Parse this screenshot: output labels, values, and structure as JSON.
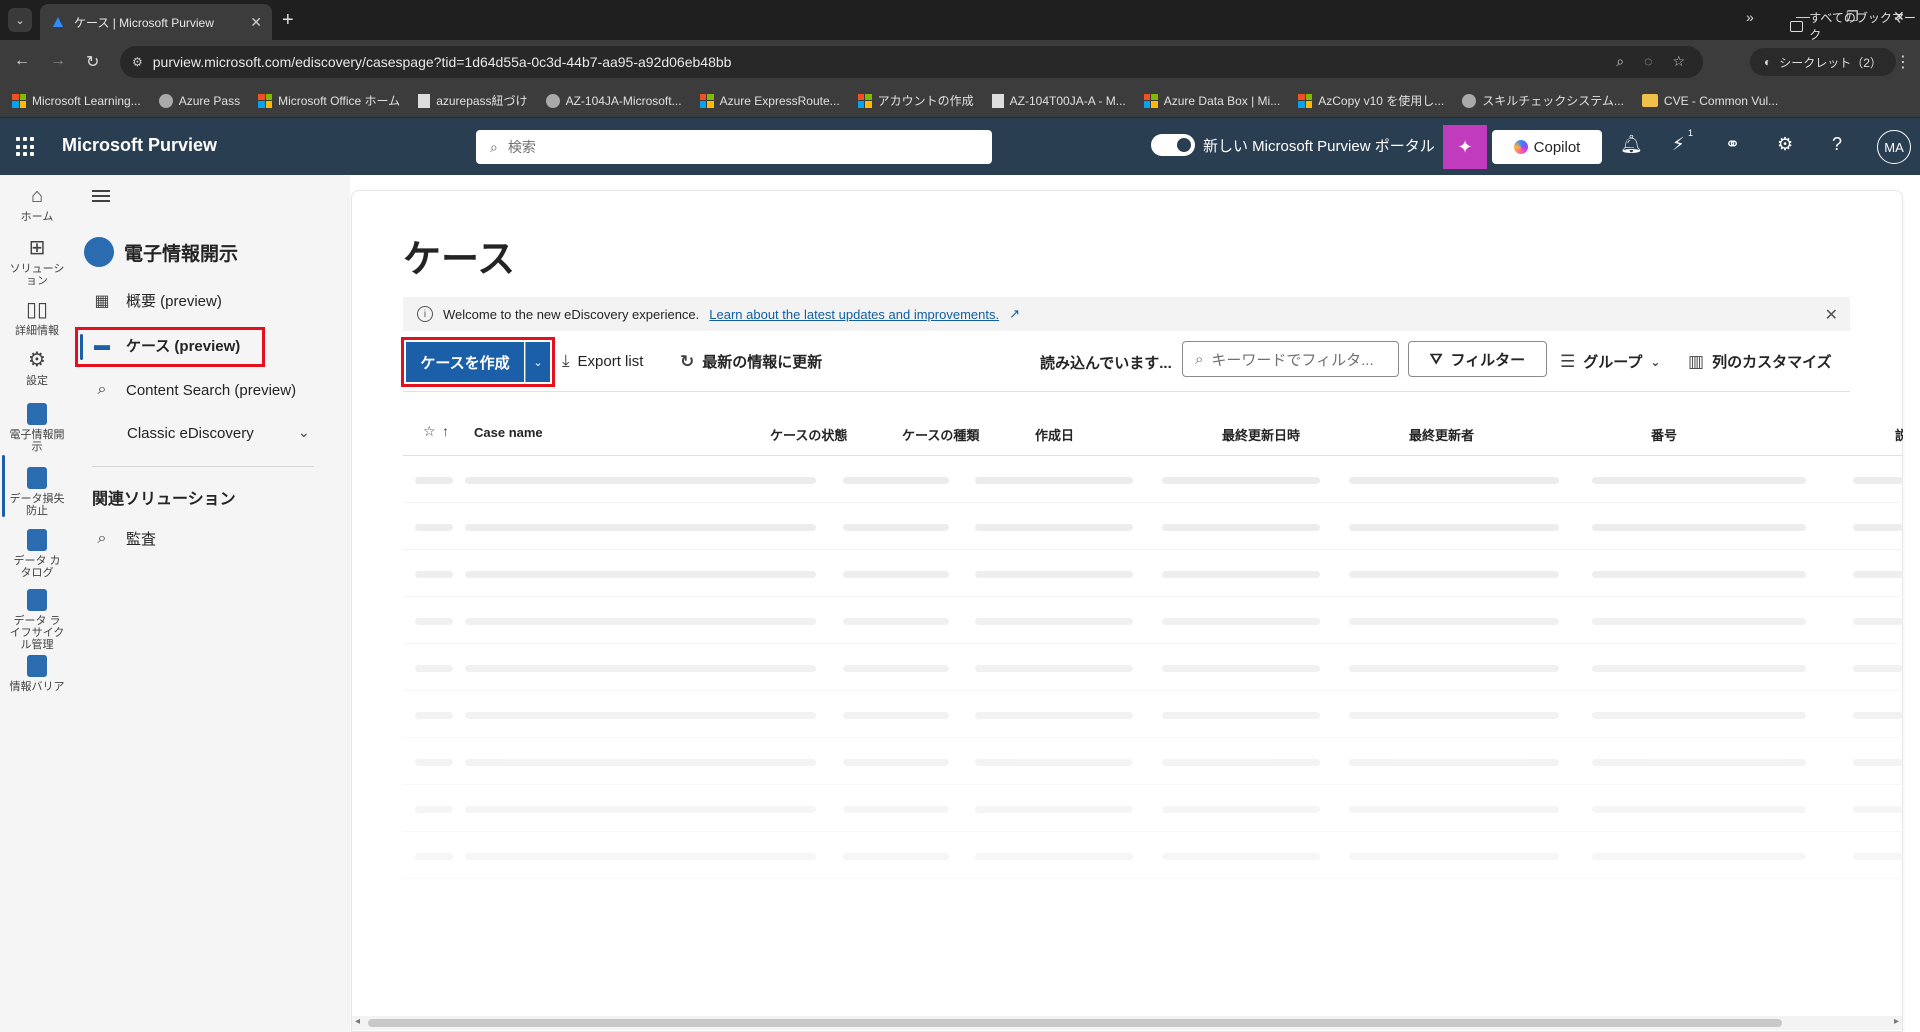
{
  "browser": {
    "tab_title": "ケース | Microsoft Purview",
    "url": "purview.microsoft.com/ediscovery/casespage?tid=1d64d55a-0c3d-44b7-aa95-a92d06eb48bb",
    "incognito_label": "シークレット（2）",
    "bookmarks": [
      {
        "label": "Microsoft Learning...",
        "icon": "ms-logo"
      },
      {
        "label": "Azure Pass",
        "icon": "globe-icon"
      },
      {
        "label": "Microsoft Office ホーム",
        "icon": "ms-logo"
      },
      {
        "label": "azurepass紐づけ",
        "icon": "doc-icon"
      },
      {
        "label": "AZ-104JA-Microsoft...",
        "icon": "github-icon"
      },
      {
        "label": "Azure ExpressRoute...",
        "icon": "ms-logo"
      },
      {
        "label": "アカウントの作成",
        "icon": "ms-logo"
      },
      {
        "label": "AZ-104T00JA-A - M...",
        "icon": "doc-icon"
      },
      {
        "label": "Azure Data Box | Mi...",
        "icon": "ms-logo"
      },
      {
        "label": "AzCopy v10 を使用し...",
        "icon": "ms-logo"
      },
      {
        "label": "スキルチェックシステム...",
        "icon": "globe-icon"
      },
      {
        "label": "CVE - Common Vul...",
        "icon": "folder-icon"
      }
    ],
    "bookmarks_more": "»",
    "all_bookmarks": "すべてのブックマーク"
  },
  "header": {
    "brand": "Microsoft Purview",
    "search_placeholder": "検索",
    "toggle_label": "新しい Microsoft Purview ポータル",
    "copilot_label": "Copilot",
    "notification_badge": "1",
    "avatar": "MA"
  },
  "rail": [
    {
      "label": "ホーム",
      "icon": "home-icon"
    },
    {
      "label": "ソリューション",
      "icon": "solutions-icon"
    },
    {
      "label": "詳細情報",
      "icon": "book-icon"
    },
    {
      "label": "設定",
      "icon": "gear-icon"
    },
    {
      "label": "電子情報開示",
      "icon": "ediscovery-icon",
      "active": true
    },
    {
      "label": "データ損失防止",
      "icon": "dlp-icon"
    },
    {
      "label": "データ カタログ",
      "icon": "catalog-icon"
    },
    {
      "label": "データ ライフサイクル管理",
      "icon": "lifecycle-icon"
    },
    {
      "label": "情報バリア",
      "icon": "barrier-icon"
    }
  ],
  "nav": {
    "title": "電子情報開示",
    "items": [
      {
        "label": "概要 (preview)",
        "icon": "overview-icon"
      },
      {
        "label": "ケース (preview)",
        "icon": "folder-icon",
        "active": true
      },
      {
        "label": "Content Search (preview)",
        "icon": "search-icon"
      },
      {
        "label": "Classic eDiscovery",
        "icon": ""
      }
    ],
    "section": "関連ソリューション",
    "related": [
      {
        "label": "監査",
        "icon": "audit-icon"
      }
    ]
  },
  "main": {
    "title": "ケース",
    "banner": {
      "text": "Welcome to the new eDiscovery experience.",
      "link": "Learn about the latest updates and improvements."
    },
    "toolbar": {
      "create": "ケースを作成",
      "export": "Export list",
      "refresh": "最新の情報に更新",
      "loading": "読み込んでいます...",
      "filter_placeholder": "キーワードでフィルタ...",
      "filter": "フィルター",
      "group": "グループ",
      "customize": "列のカスタマイズ"
    },
    "columns": [
      "Case name",
      "ケースの状態",
      "ケースの種類",
      "作成日",
      "最終更新日時",
      "最終更新者",
      "番号",
      "説"
    ]
  },
  "colors": {
    "accent": "#1b5fa8",
    "header_bg": "#2a3e52",
    "highlight": "#e3101d",
    "copilot_accent": "#c13bbd"
  }
}
